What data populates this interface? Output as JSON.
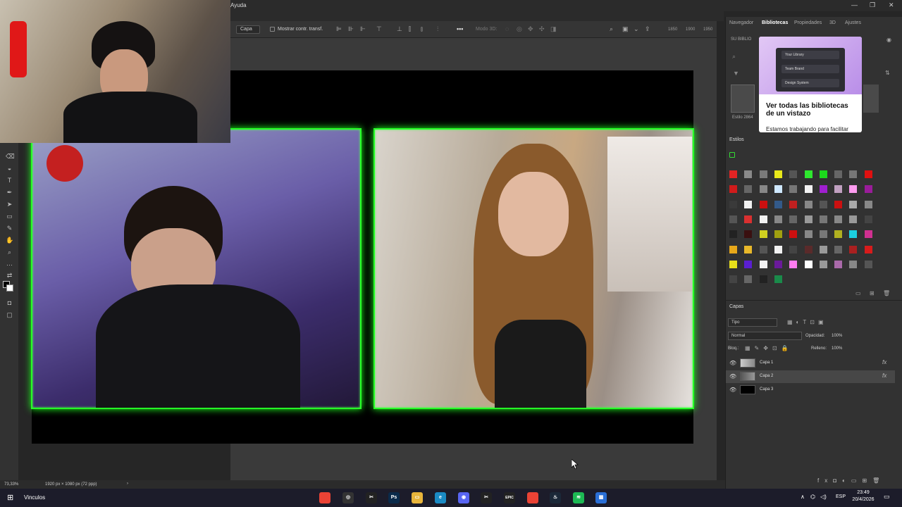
{
  "menubar": {
    "menu_help": "Ayuda",
    "win_min": "—",
    "win_max": "❐",
    "win_close": "✕"
  },
  "options": {
    "layer_select": "Capa",
    "transform_label": "Mostrar contr. transf.",
    "mode_3d": "Modo 3D:",
    "ruler_1850": "1850",
    "ruler_1900": "1900",
    "ruler_1950": "1950"
  },
  "panel_tabs": {
    "navigator": "Navegador",
    "libraries": "Bibliotecas",
    "properties": "Propiedades",
    "three_d": "3D",
    "adjustments": "Ajustes"
  },
  "libraries": {
    "back_label": "SU BIBLIO",
    "style_label": "Estilo 2864",
    "popup_rows": [
      "Your Library",
      "Team Brand",
      "Design System"
    ],
    "popup_title": "Ver todas las bibliotecas de un vistazo",
    "popup_body": "Estamos trabajando para facilitar"
  },
  "styles": {
    "title": "Estilos"
  },
  "layers": {
    "title": "Capas",
    "filter": "Tipo",
    "blend": "Normal",
    "opacity_label": "Opacidad:",
    "opacity_value": "100%",
    "lock_label": "Bloq.:",
    "fill_label": "Relleno:",
    "fill_value": "100%",
    "items": [
      {
        "name": "Capa 1",
        "fx": "fx"
      },
      {
        "name": "Capa 2",
        "fx": "fx"
      },
      {
        "name": "Capa 3",
        "fx": ""
      }
    ]
  },
  "status": {
    "zoom": "73,33%",
    "doc_size": "1920 px × 1080 px (72 ppp)"
  },
  "taskbar": {
    "links": "Vinculos",
    "lang": "ESP",
    "time": "23:49",
    "date": "20/4/2026",
    "apps": [
      {
        "name": "chrome-icon",
        "glyph": "",
        "color": "#ea4335"
      },
      {
        "name": "obs-icon",
        "glyph": "◎",
        "color": "#333"
      },
      {
        "name": "capcut-icon",
        "glyph": "✂",
        "color": "#222"
      },
      {
        "name": "photoshop-icon",
        "glyph": "Ps",
        "color": "#0a2a4a"
      },
      {
        "name": "explorer-icon",
        "glyph": "▭",
        "color": "#e8b53b"
      },
      {
        "name": "edge-icon",
        "glyph": "e",
        "color": "#1a8ac4"
      },
      {
        "name": "discord-icon",
        "glyph": "◉",
        "color": "#5865f2"
      },
      {
        "name": "capcut-2-icon",
        "glyph": "✂",
        "color": "#222"
      },
      {
        "name": "epic-icon",
        "glyph": "EPIC",
        "color": "#222"
      },
      {
        "name": "chrome-2-icon",
        "glyph": "",
        "color": "#ea4335"
      },
      {
        "name": "steam-icon",
        "glyph": "♨",
        "color": "#1b2838"
      },
      {
        "name": "spotify-icon",
        "glyph": "≋",
        "color": "#1db954"
      },
      {
        "name": "app-icon",
        "glyph": "▦",
        "color": "#2a6fd6"
      }
    ]
  },
  "swatch_colors": [
    [
      "#e32424",
      "#8a8a8a",
      "#7a7a7a",
      "#e8e81a",
      "#555",
      "#2ee82e",
      "#1cd81c",
      "#666",
      "#777",
      "#e01010"
    ],
    [
      "#d01b1b",
      "#666",
      "#888",
      "#cfe8ff",
      "#777",
      "#f2f2f2",
      "#a01fd0",
      "#c0a0c0",
      "#ff9cf0",
      "#9a1c9a"
    ],
    [
      "#3a3a3a",
      "#f2f2f2",
      "#cc1010",
      "#335a8a",
      "#c02020",
      "#888",
      "#555",
      "#cc1010",
      "#aaa",
      "#888"
    ],
    [
      "#555",
      "#d93030",
      "#f2f2f2",
      "#888",
      "#666",
      "#999",
      "#777",
      "#888",
      "#999",
      "#444"
    ],
    [
      "#222",
      "#3a1010",
      "#d0d020",
      "#a0a010",
      "#cc1010",
      "#888",
      "#777",
      "#b0b020",
      "#1cd0e0",
      "#d03090"
    ],
    [
      "#e8a81a",
      "#e8b82a",
      "#555",
      "#f2f2f2",
      "#444",
      "#5a2a2a",
      "#999",
      "#666",
      "#aa2020",
      "#d81b1b"
    ],
    [
      "#e8e01a",
      "#5a1fd0",
      "#f2f2f2",
      "#6a1a9a",
      "#ff7cf0",
      "#ffffff",
      "#999",
      "#aa6aaa",
      "#888",
      "#555"
    ],
    [
      "#444",
      "#666",
      "#222",
      "#1a8a4a",
      "",
      "",
      "",
      "",
      "",
      ""
    ]
  ]
}
